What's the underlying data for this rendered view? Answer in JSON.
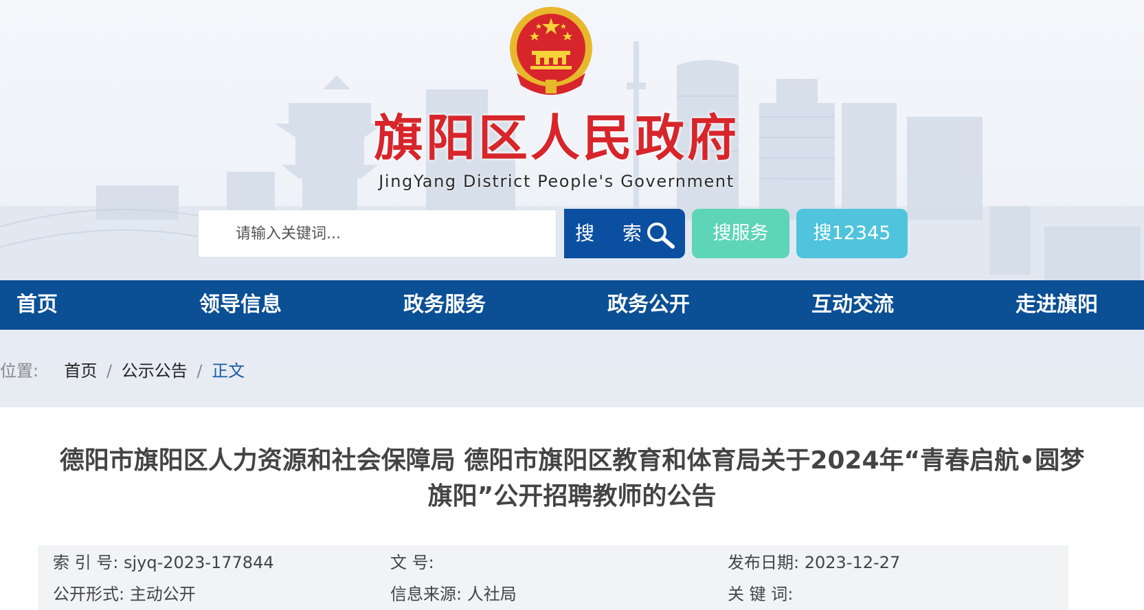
{
  "header": {
    "title": "旗阳区人民政府",
    "subtitle": "JingYang District People's Government",
    "emblem_icon": "national-emblem-icon"
  },
  "search": {
    "placeholder": "请输入关键词...",
    "button_label": "搜 索",
    "service_label": "搜服务",
    "hotline_label": "搜12345"
  },
  "nav": {
    "items": [
      "首页",
      "领导信息",
      "政务服务",
      "政务公开",
      "互动交流",
      "走进旗阳"
    ]
  },
  "breadcrumb": {
    "prefix": "位置:",
    "items": [
      "首页",
      "公示公告",
      "正文"
    ],
    "separator": "/"
  },
  "article": {
    "title_line1": "德阳市旗阳区人力资源和社会保障局 德阳市旗阳区教育和体育局关于2024年“青春启航•圆梦",
    "title_line2": "旗阳”公开招聘教师的公告"
  },
  "meta": {
    "index_label": "索 引 号:",
    "index_value": "sjyq-2023-177844",
    "doc_no_label": "文 号:",
    "doc_no_value": "",
    "date_label": "发布日期:",
    "date_value": "2023-12-27",
    "form_label": "公开形式:",
    "form_value": "主动公开",
    "source_label": "信息来源:",
    "source_value": "人社局",
    "keywords_label": "关 键 词:",
    "keywords_value": ""
  },
  "colors": {
    "title_red": "#d7262b",
    "nav_blue": "#0b4f95",
    "search_blue": "#0b4fa0",
    "service_green": "#5ed4b8",
    "hotline_cyan": "#4fc4dc"
  }
}
